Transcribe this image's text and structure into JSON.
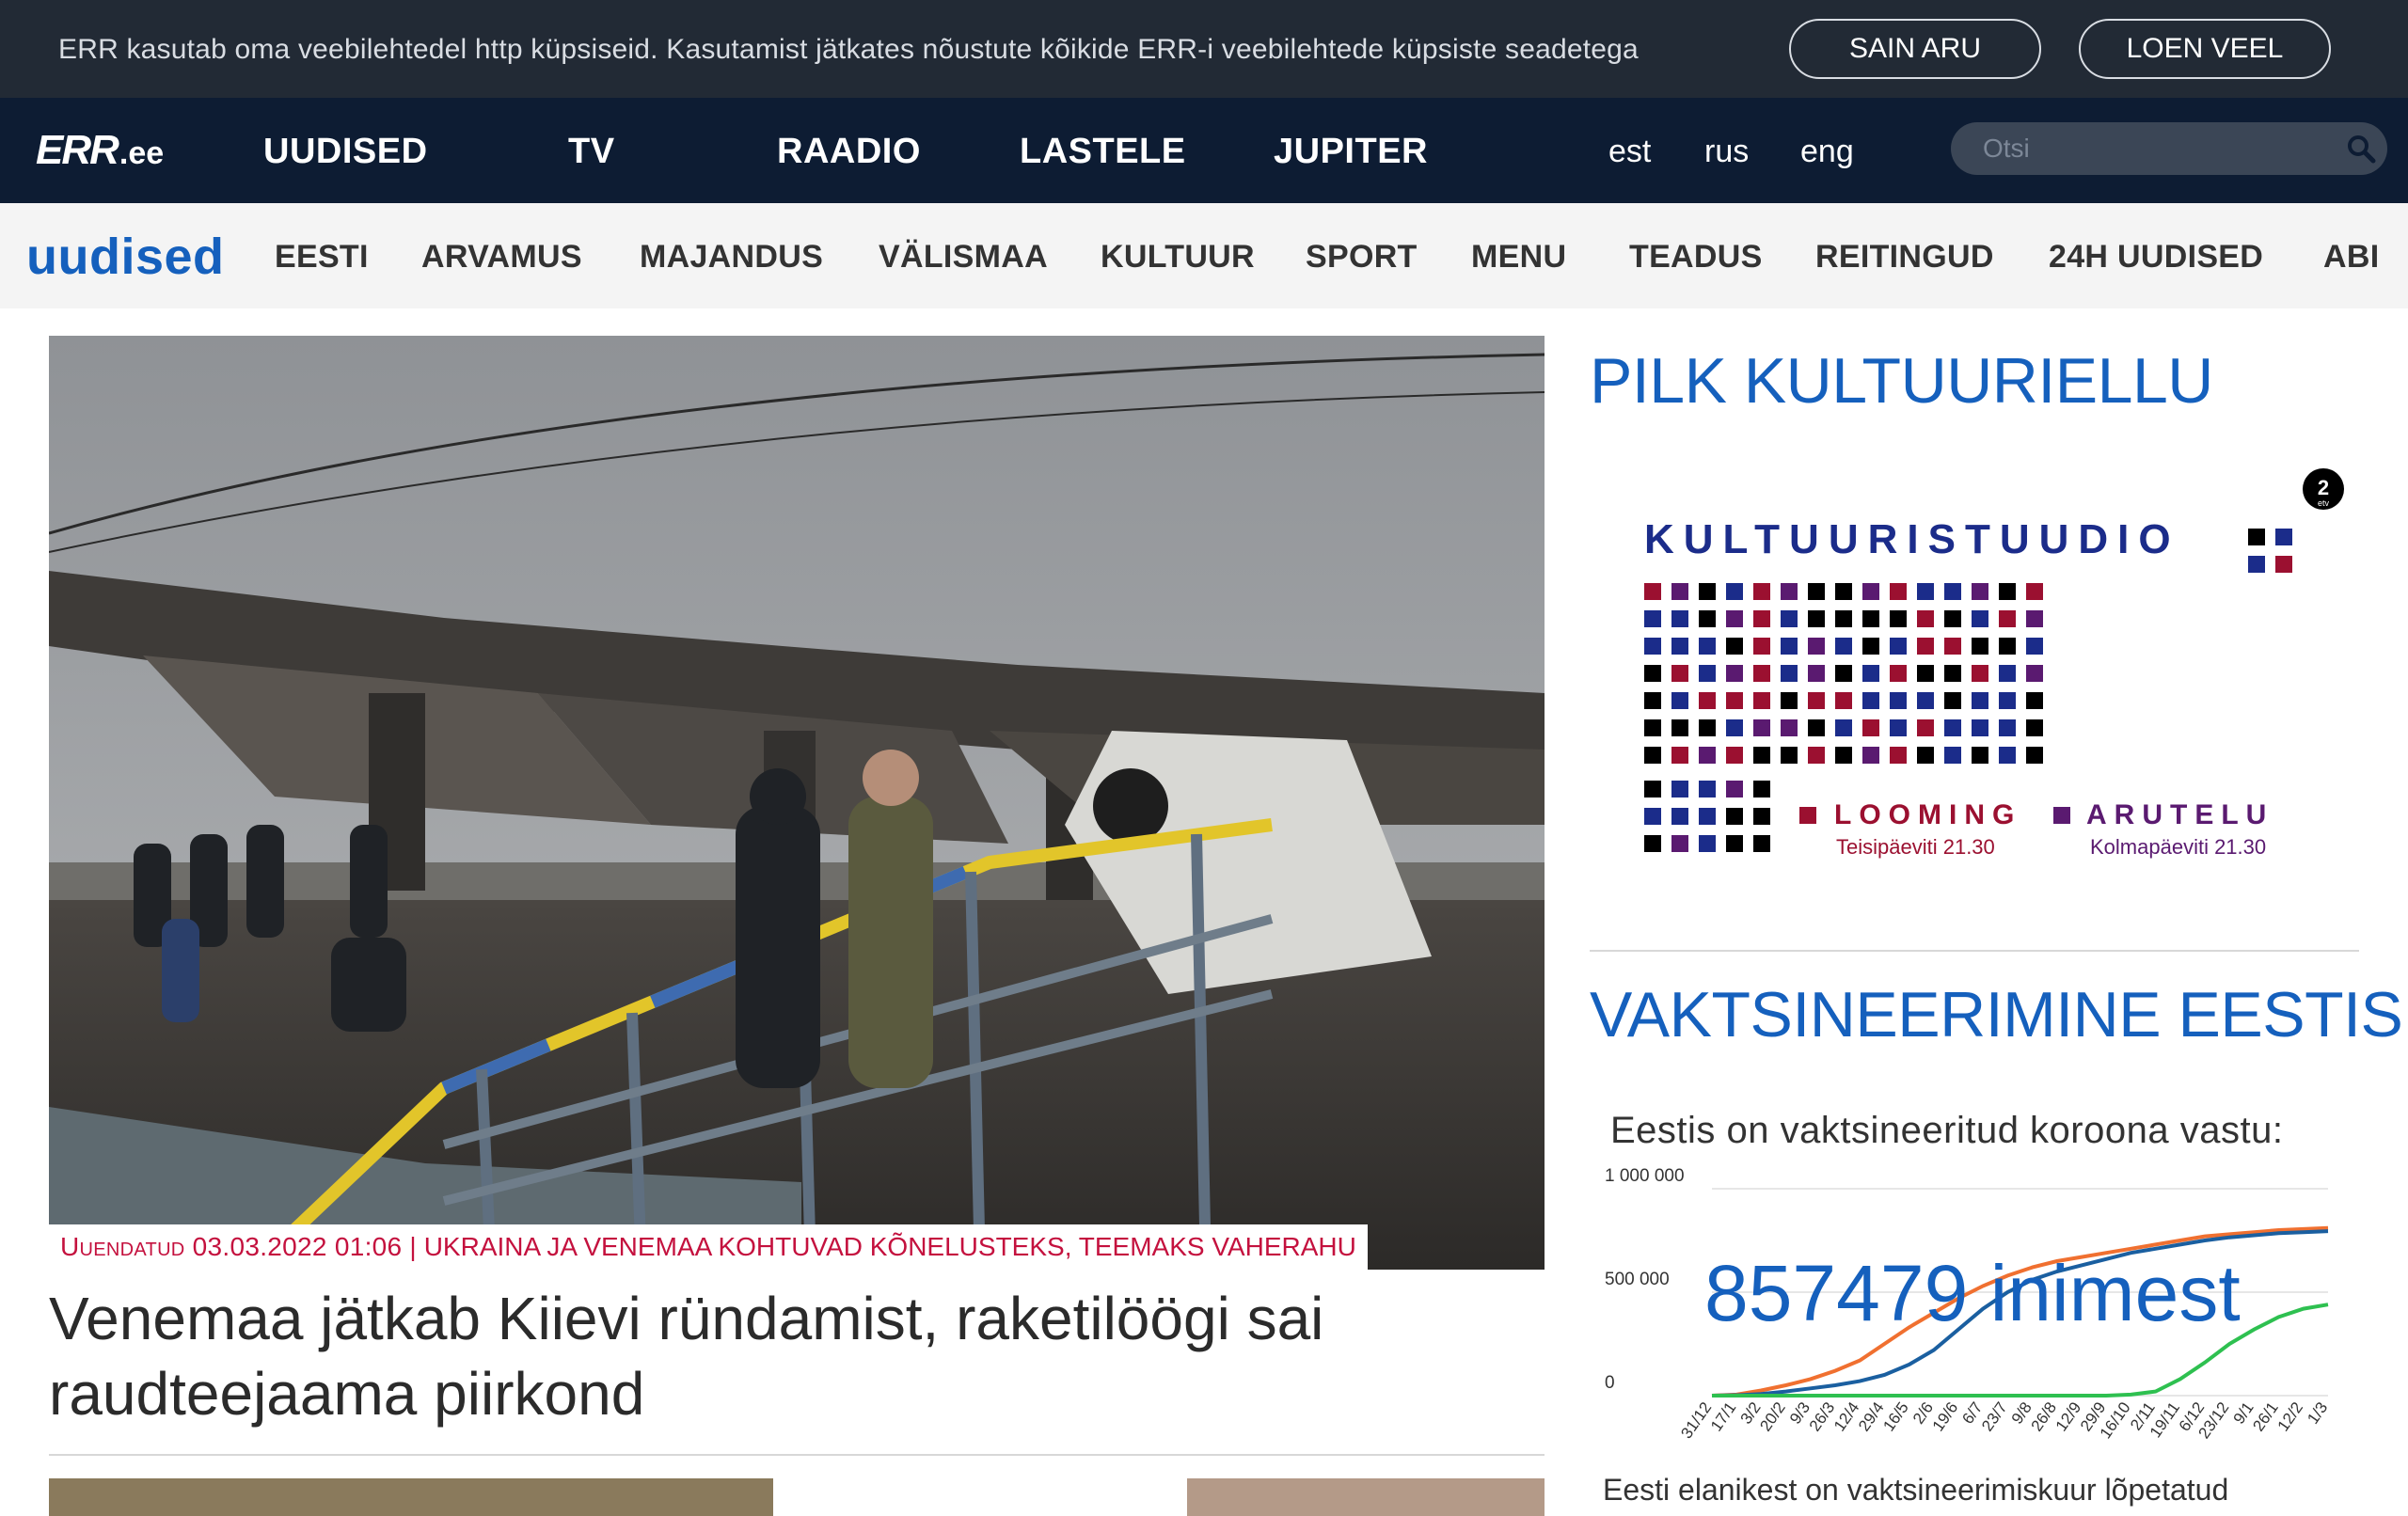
{
  "cookie": {
    "text": "ERR kasutab oma veebilehtedel http küpsiseid. Kasutamist jätkates nõustute kõikide ERR-i veebilehtede küpsiste seadetega",
    "agree_label": "SAIN ARU",
    "more_label": "LOEN VEEL"
  },
  "topnav": {
    "logo_main": "ERR",
    "logo_suffix": ".ee",
    "items": [
      "UUDISED",
      "TV",
      "RAADIO",
      "LASTELE",
      "JUPITER"
    ],
    "languages": [
      "est",
      "rus",
      "eng"
    ],
    "search_placeholder": "Otsi"
  },
  "secnav": {
    "logo": "uudised",
    "items": [
      "EESTI",
      "ARVAMUS",
      "MAJANDUS",
      "VÄLISMAA",
      "KULTUUR",
      "SPORT",
      "MENU",
      "TEADUS",
      "REITINGUD",
      "24H UUDISED",
      "ABI"
    ]
  },
  "article": {
    "updated": "Uuendatud 03.03.2022 01:06",
    "separator": "|",
    "related": "UKRAINA JA VENEMAA KOHTUVAD KÕNELUSTEKS, TEEMAKS VAHERAHU",
    "headline": "Venemaa jätkab Kiievi ründamist, raketilöögi sai raudteejaama piirkond"
  },
  "sidebar": {
    "block1_title": "PILK KULTUURIELLU",
    "kultuuristuudio": {
      "title": "KULTUURISTUUDIO",
      "channel_badge": "2",
      "channel_small": "etv",
      "show1": "LOOMING",
      "show1_time": "Teisipäeviti 21.30",
      "show2": "ARUTELU",
      "show2_time": "Kolmapäeviti 21.30"
    },
    "block2_title": "VAKTSINEERIMINE EESTIS",
    "vax_subtitle": "Eestis on vaktsineeritud koroona vastu:",
    "vax_count": "857479",
    "vax_unit": "inimest",
    "vax_bottom": "Eesti elanikest on vaktsineerimiskuur lõpetatud"
  },
  "colors": {
    "brand_blue": "#1560bd",
    "nav_dark": "#0d1c33",
    "cookie_bg": "#222a35",
    "caption_red": "#c4113e",
    "series_orange": "#f07030",
    "series_blue": "#1a5fa0",
    "series_green": "#2ec050"
  },
  "chart_data": {
    "type": "line",
    "title": "",
    "ytick_labels": [
      "1 000 000",
      "500 000",
      "0"
    ],
    "ylim": [
      0,
      1000000
    ],
    "x": [
      "31/12",
      "17/1",
      "3/2",
      "20/2",
      "9/3",
      "26/3",
      "12/4",
      "29/4",
      "16/5",
      "2/6",
      "19/6",
      "6/7",
      "23/7",
      "9/8",
      "26/8",
      "12/9",
      "29/9",
      "16/10",
      "2/11",
      "19/11",
      "6/12",
      "23/12",
      "9/1",
      "26/1",
      "12/2",
      "1/3"
    ],
    "series": [
      {
        "name": "",
        "color": "#f07030",
        "values": [
          0,
          5000,
          25000,
          50000,
          80000,
          120000,
          170000,
          250000,
          330000,
          400000,
          470000,
          530000,
          580000,
          620000,
          650000,
          670000,
          690000,
          710000,
          730000,
          750000,
          770000,
          780000,
          790000,
          800000,
          805000,
          810000
        ]
      },
      {
        "name": "",
        "color": "#1a5fa0",
        "values": [
          0,
          2000,
          8000,
          20000,
          35000,
          50000,
          70000,
          100000,
          150000,
          220000,
          320000,
          420000,
          500000,
          560000,
          600000,
          630000,
          660000,
          690000,
          710000,
          730000,
          750000,
          765000,
          775000,
          785000,
          790000,
          795000
        ]
      },
      {
        "name": "",
        "color": "#2ec050",
        "values": [
          0,
          0,
          0,
          0,
          0,
          0,
          0,
          0,
          0,
          0,
          0,
          0,
          0,
          0,
          0,
          0,
          0,
          5000,
          20000,
          80000,
          160000,
          250000,
          320000,
          380000,
          420000,
          440000
        ]
      }
    ],
    "grid": true,
    "legend": "none"
  }
}
